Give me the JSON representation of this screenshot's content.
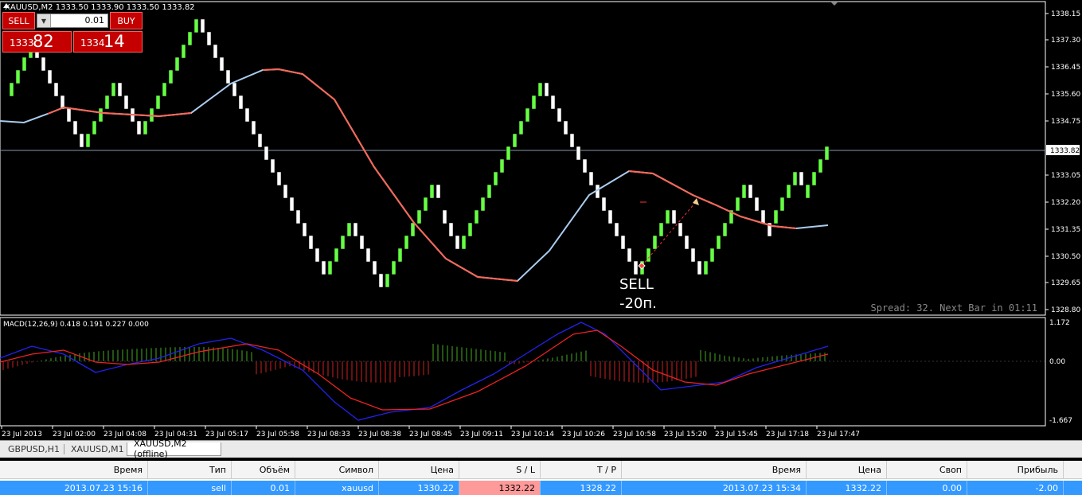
{
  "chart": {
    "header": "XAUUSD,M2  1333.50 1333.90 1333.50 1333.82",
    "price_axis": [
      "1338.15",
      "1337.30",
      "1336.45",
      "1335.60",
      "1334.75",
      "1333.05",
      "1332.20",
      "1331.35",
      "1330.50",
      "1329.65",
      "1328.80"
    ],
    "current_price": "1333.82",
    "spread_text": "Spread: 32. Next Bar in 01:11",
    "annotation_sell": "SELL",
    "annotation_pips": "-20п.",
    "macd_label": "MACD(12,26,9) 0.418 0.191 0.227 0.000",
    "macd_axis": [
      "1.172",
      "0.00",
      "-1.667"
    ],
    "time_axis": [
      "23 Jul 2013",
      "23 Jul 02:00",
      "23 Jul 04:08",
      "23 Jul 04:31",
      "23 Jul 05:17",
      "23 Jul 05:58",
      "23 Jul 08:33",
      "23 Jul 08:38",
      "23 Jul 08:45",
      "23 Jul 09:11",
      "23 Jul 10:14",
      "23 Jul 10:26",
      "23 Jul 10:58",
      "23 Jul 15:20",
      "23 Jul 15:45",
      "23 Jul 17:18",
      "23 Jul 17:47"
    ],
    "colors": {
      "bull": "#66ff44",
      "bear": "#ffffff",
      "ma_up": "#aaccee",
      "ma_down": "#ff6655",
      "macd_main": "#2222ee",
      "macd_signal": "#ee2222"
    }
  },
  "trade_panel": {
    "sell_label": "SELL",
    "buy_label": "BUY",
    "lot": "0.01",
    "sell_small": "1333",
    "sell_big": "82",
    "buy_small": "1334",
    "buy_big": "14"
  },
  "tabs": [
    {
      "label": "GBPUSD,H1"
    },
    {
      "label": "XAUUSD,M1"
    },
    {
      "label": "XAUUSD,M2 (offline)"
    }
  ],
  "orders": {
    "columns": [
      "Время",
      "Тип",
      "Объём",
      "Символ",
      "Цена",
      "S / L",
      "T / P",
      "Время",
      "Цена",
      "Своп",
      "Прибыль"
    ],
    "row": [
      "2013.07.23 15:16",
      "sell",
      "0.01",
      "xauusd",
      "1330.22",
      "1332.22",
      "1328.22",
      "2013.07.23 15:34",
      "1332.22",
      "0.00",
      "-2.00"
    ]
  }
}
